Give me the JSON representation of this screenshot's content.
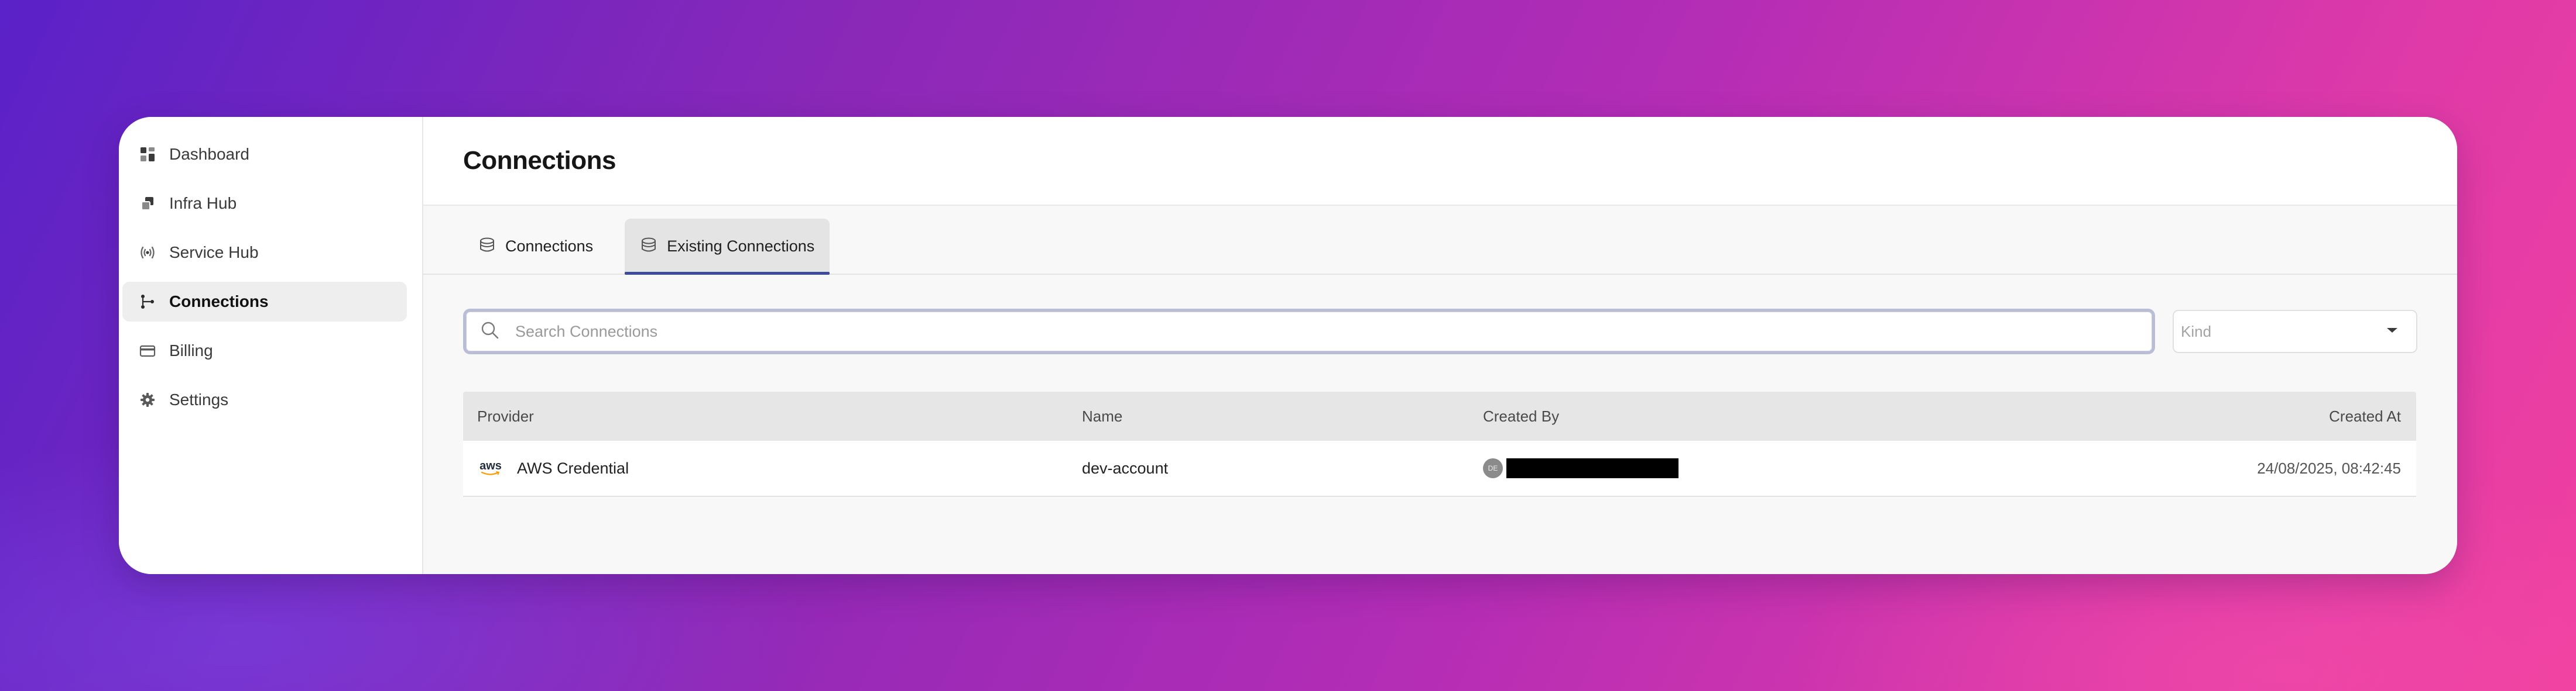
{
  "sidebar": {
    "items": [
      {
        "label": "Dashboard",
        "icon": "dashboard-icon",
        "active": false
      },
      {
        "label": "Infra Hub",
        "icon": "cubes-icon",
        "active": false
      },
      {
        "label": "Service Hub",
        "icon": "broadcast-icon",
        "active": false
      },
      {
        "label": "Connections",
        "icon": "connections-icon",
        "active": true
      },
      {
        "label": "Billing",
        "icon": "credit-card-icon",
        "active": false
      },
      {
        "label": "Settings",
        "icon": "gear-icon",
        "active": false
      }
    ]
  },
  "header": {
    "title": "Connections"
  },
  "tabs": [
    {
      "label": "Connections",
      "icon": "database-icon",
      "active": false
    },
    {
      "label": "Existing Connections",
      "icon": "database-icon",
      "active": true
    }
  ],
  "search": {
    "placeholder": "Search Connections",
    "value": ""
  },
  "kind_filter": {
    "placeholder": "Kind"
  },
  "table": {
    "columns": [
      "Provider",
      "Name",
      "Created By",
      "Created At"
    ],
    "rows": [
      {
        "provider": "AWS Credential",
        "provider_logo_text": "aws",
        "name": "dev-account",
        "created_by_avatar": "DE",
        "created_at": "24/08/2025, 08:42:45"
      }
    ]
  },
  "colors": {
    "accent": "#3e4a9a",
    "search_border": "#b9bdd6",
    "active_nav_bg": "#eeeeee",
    "gradient_start": "#5a22c8",
    "gradient_end": "#f040a0"
  }
}
